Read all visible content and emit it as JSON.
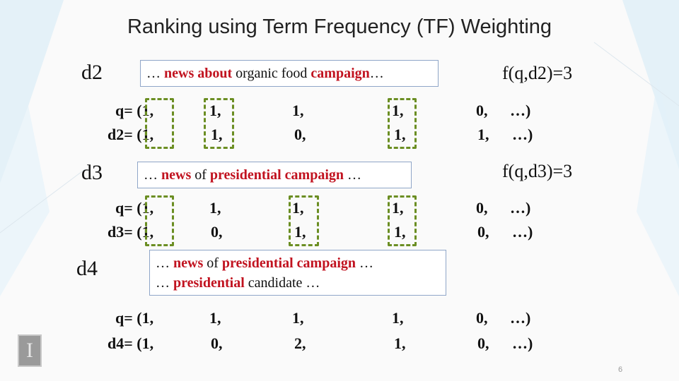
{
  "slide": {
    "title": "Ranking using Term Frequency (TF) Weighting",
    "page_number": "6",
    "logo_glyph": "I"
  },
  "blocks": [
    {
      "doc_label": "d2",
      "score": "f(q,d2)=3",
      "snippet_lines": [
        [
          {
            "t": "… ",
            "hl": false
          },
          {
            "t": "news about",
            "hl": true
          },
          {
            "t": " organic food ",
            "hl": false
          },
          {
            "t": "campaign",
            "hl": true
          },
          {
            "t": "…",
            "hl": false
          }
        ]
      ],
      "q_row": [
        "q= (1,",
        "1,",
        "1,",
        "1,",
        "0,",
        "…)"
      ],
      "d_row": [
        "d2= (1,",
        "1,",
        "0,",
        "1,",
        "1,",
        "…)"
      ]
    },
    {
      "doc_label": "d3",
      "score": "f(q,d3)=3",
      "snippet_lines": [
        [
          {
            "t": "… ",
            "hl": false
          },
          {
            "t": "news",
            "hl": true
          },
          {
            "t": " of ",
            "hl": false
          },
          {
            "t": "presidential campaign",
            "hl": true
          },
          {
            "t": " …",
            "hl": false
          }
        ]
      ],
      "q_row": [
        "q= (1,",
        "1,",
        "1,",
        "1,",
        "0,",
        "…)"
      ],
      "d_row": [
        "d3= (1,",
        "0,",
        "1,",
        "1,",
        "0,",
        "…)"
      ]
    },
    {
      "doc_label": "d4",
      "score": "",
      "snippet_lines": [
        [
          {
            "t": "… ",
            "hl": false
          },
          {
            "t": "news",
            "hl": true
          },
          {
            "t": " of ",
            "hl": false
          },
          {
            "t": "presidential campaign",
            "hl": true
          },
          {
            "t": " …",
            "hl": false
          }
        ],
        [
          {
            "t": "… ",
            "hl": false
          },
          {
            "t": "presidential",
            "hl": true
          },
          {
            "t": " candidate …",
            "hl": false
          }
        ]
      ],
      "q_row": [
        "q= (1,",
        "1,",
        "1,",
        "1,",
        "0,",
        "…)"
      ],
      "d_row": [
        "d4= (1,",
        "0,",
        "2,",
        "1,",
        "0,",
        "…)"
      ]
    }
  ],
  "colors": {
    "highlight_word": "#c1121f",
    "match_box": "#6b8e23",
    "snippet_border": "#8fa6c8"
  }
}
